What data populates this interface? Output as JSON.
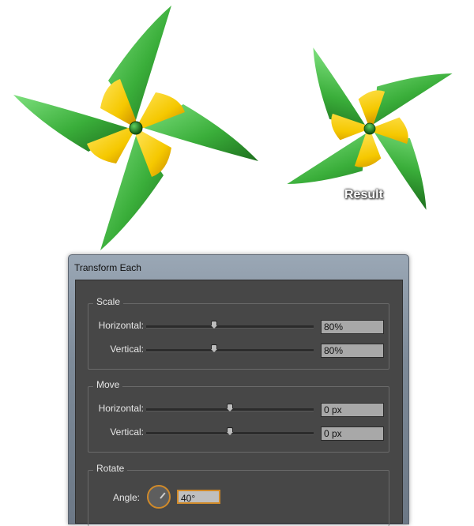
{
  "result_label": "Result",
  "colors": {
    "green_dark": "#1f7a1f",
    "green_light": "#6fd66f",
    "yellow": "#f5c800",
    "yellow_dark": "#d69600",
    "accent_orange": "#d08a2a"
  },
  "dialog": {
    "title": "Transform Each",
    "scale": {
      "label": "Scale",
      "horizontal_label": "Horizontal:",
      "vertical_label": "Vertical:",
      "horizontal_value": "80%",
      "vertical_value": "80%",
      "horizontal_slider_percent": 80,
      "vertical_slider_percent": 80
    },
    "move": {
      "label": "Move",
      "horizontal_label": "Horizontal:",
      "vertical_label": "Vertical:",
      "horizontal_value": "0 px",
      "vertical_value": "0 px"
    },
    "rotate": {
      "label": "Rotate",
      "angle_label": "Angle:",
      "angle_value": "40°"
    }
  }
}
